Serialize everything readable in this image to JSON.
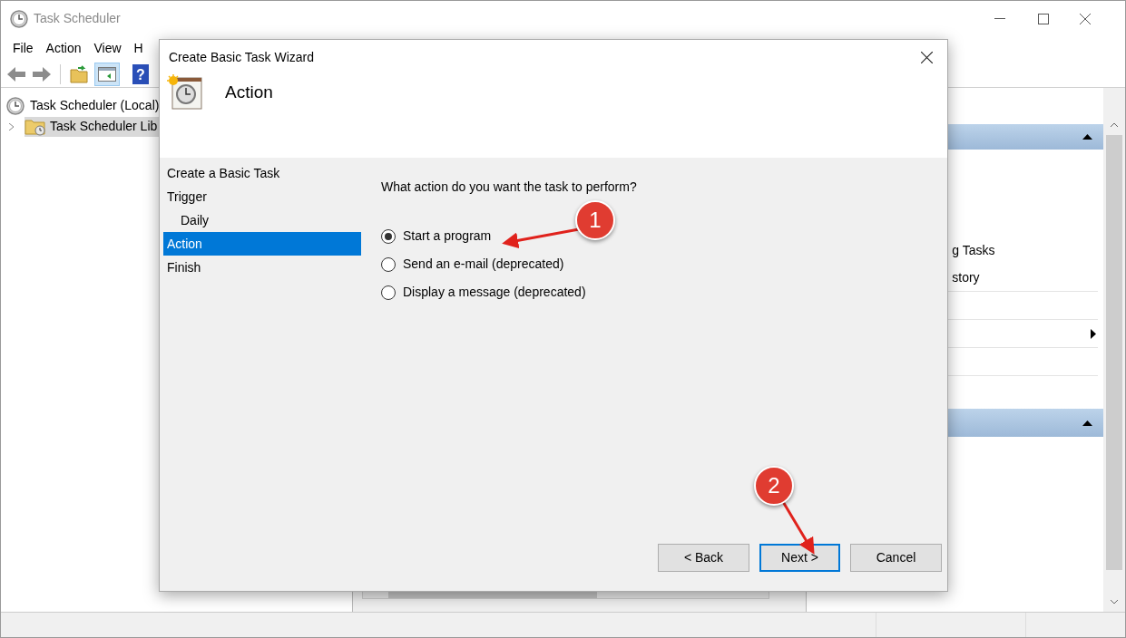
{
  "window": {
    "title": "Task Scheduler"
  },
  "menu": [
    "File",
    "Action",
    "View",
    "H"
  ],
  "toolbar": {
    "help_glyph": "?"
  },
  "tree": [
    {
      "label": "Task Scheduler (Local)",
      "children": [
        {
          "label": "Task Scheduler Lib",
          "expanded": false,
          "selected": true
        }
      ]
    }
  ],
  "actions_pane": {
    "items": [
      "g Tasks",
      "story"
    ]
  },
  "dialog": {
    "title": "Create Basic Task Wizard",
    "heading": "Action",
    "steps": [
      {
        "label": "Create a Basic Task",
        "selected": false
      },
      {
        "label": "Trigger",
        "selected": false,
        "children": [
          {
            "label": "Daily",
            "selected": false
          }
        ]
      },
      {
        "label": "Action",
        "selected": true
      },
      {
        "label": "Finish",
        "selected": false
      }
    ],
    "question": "What action do you want the task to perform?",
    "options": [
      {
        "label": "Start a program",
        "selected": true
      },
      {
        "label": "Send an e-mail (deprecated)",
        "selected": false
      },
      {
        "label": "Display a message (deprecated)",
        "selected": false
      }
    ],
    "buttons": [
      {
        "label": "< Back",
        "default": false
      },
      {
        "label": "Next >",
        "default": true
      },
      {
        "label": "Cancel",
        "default": false
      }
    ]
  },
  "callouts": [
    {
      "number": "1"
    },
    {
      "number": "2"
    }
  ]
}
